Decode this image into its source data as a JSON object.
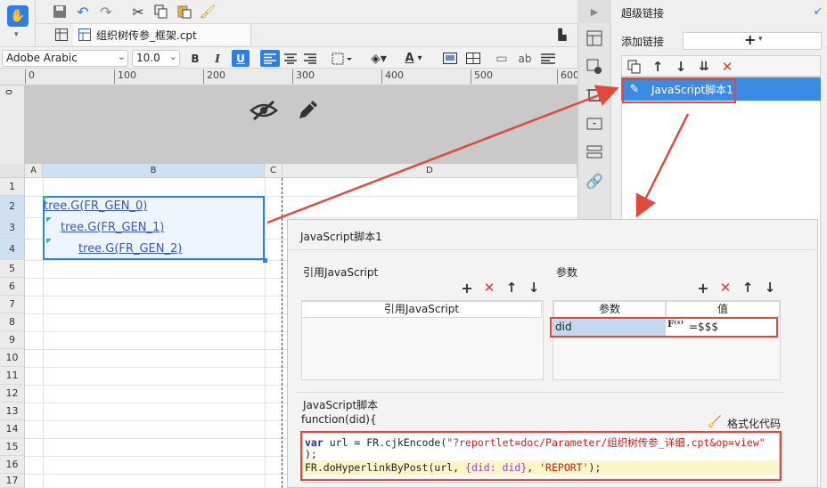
{
  "designer": {
    "tab_label": "组织树传参_框架.cpt",
    "font_name": "Adobe Arabic",
    "font_size": "10.0",
    "bold_label": "B",
    "italic_label": "I",
    "underline_label": "U",
    "text_color_label": "A",
    "ab_label": "ab"
  },
  "ruler": {
    "ticks": [
      "0",
      "100",
      "200",
      "300",
      "400",
      "500",
      "600"
    ],
    "vertical_label": "0"
  },
  "grid": {
    "columns": [
      "A",
      "B",
      "C",
      "D"
    ],
    "rows": [
      "1",
      "2",
      "3",
      "4",
      "5",
      "6",
      "7",
      "8",
      "9",
      "10",
      "11",
      "12",
      "13",
      "14",
      "15",
      "16",
      "17"
    ],
    "cells": [
      "tree.G(FR_GEN_0)",
      "tree.G(FR_GEN_1)",
      "tree.G(FR_GEN_2)"
    ]
  },
  "hyperlink_panel": {
    "title": "超级链接",
    "add_label": "添加链接",
    "add_button": "+",
    "item": "JavaScript脚本1"
  },
  "dialog": {
    "title": "JavaScript脚本1",
    "ref_js_title": "引用JavaScript",
    "ref_js_col": "引用JavaScript",
    "params_title": "参数",
    "param_col": "参数",
    "value_col": "值",
    "param_name": "did",
    "param_value": "=$$$",
    "script_title": "JavaScript脚本",
    "func_sig": "function(did){",
    "format_label": "格式化代码",
    "code": {
      "kw_var": "var",
      "l1_a": " url = FR.cjkEncode(",
      "l1_str": "\"?reportlet=doc/Parameter/组织树传参_详细.cpt&op=view\"",
      "l2": ");",
      "l3_a": "FR.doHyperlinkByPost(url, ",
      "l3_obj": "{did: did}",
      "l3_b": ", ",
      "l3_str": "'REPORT'",
      "l3_end": ");"
    }
  },
  "colors": {
    "accent": "#3b8ae3",
    "highlight_red": "#e04a3c",
    "link_blue": "#3b57b8",
    "selection": "#2f7fe0"
  }
}
